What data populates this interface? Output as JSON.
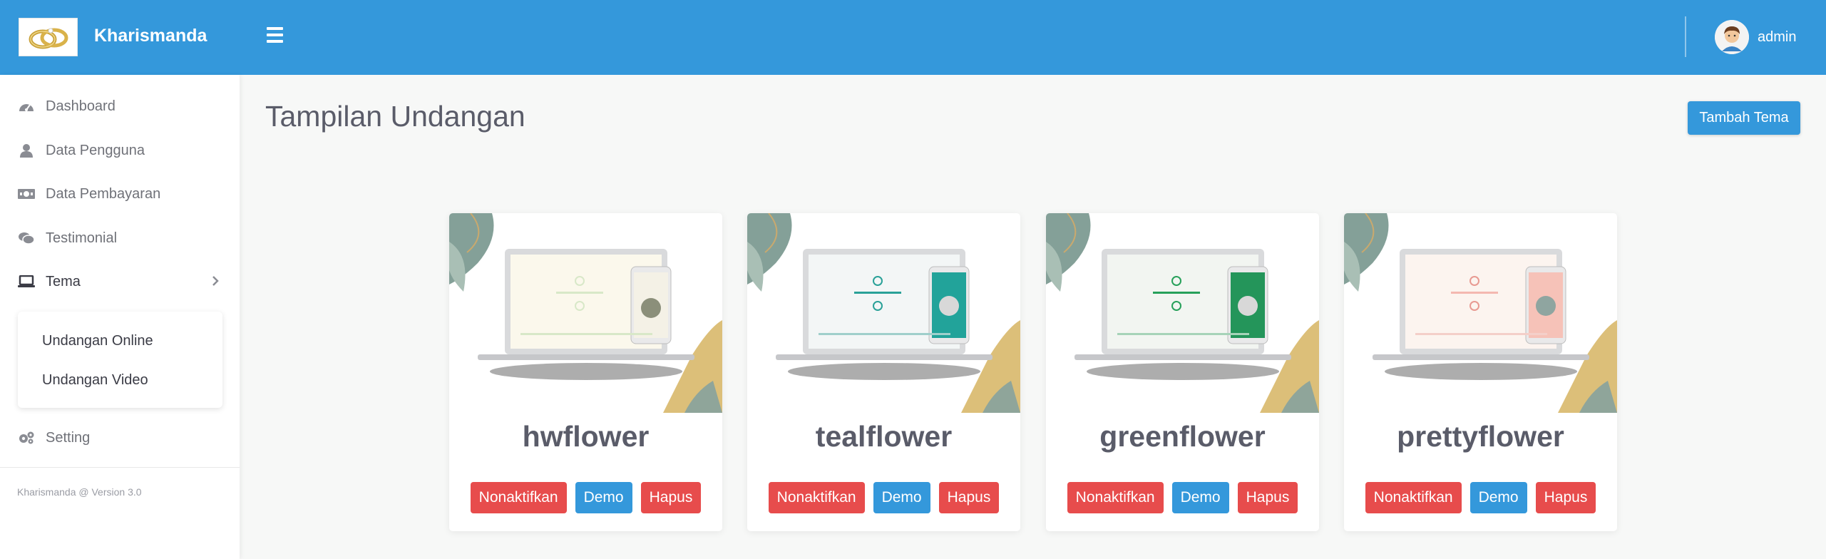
{
  "header": {
    "brand": "Kharismanda",
    "user": "admin",
    "logo_icon": "wedding-rings-icon",
    "menu_icon": "hamburger-icon"
  },
  "sidebar": {
    "items": [
      {
        "label": "Dashboard",
        "icon": "dashboard-icon"
      },
      {
        "label": "Data Pengguna",
        "icon": "user-icon"
      },
      {
        "label": "Data Pembayaran",
        "icon": "money-icon"
      },
      {
        "label": "Testimonial",
        "icon": "comments-icon"
      },
      {
        "label": "Tema",
        "icon": "laptop-icon"
      },
      {
        "label": "Setting",
        "icon": "cogs-icon"
      }
    ],
    "submenu": [
      "Undangan Online",
      "Undangan Video"
    ],
    "version": "Kharismanda @ Version 3.0"
  },
  "main": {
    "title": "Tampilan Undangan",
    "add_button": "Tambah Tema",
    "themes": [
      {
        "name": "hwflower",
        "accent": "#d8e8c8",
        "phone": "#f4f1e6"
      },
      {
        "name": "tealflower",
        "accent": "#2aa198",
        "phone": "#22a39a"
      },
      {
        "name": "greenflower",
        "accent": "#27a05a",
        "phone": "#24955a"
      },
      {
        "name": "prettyflower",
        "accent": "#f4b8b0",
        "phone": "#f6c2b8"
      }
    ],
    "actions": {
      "deactivate": "Nonaktifkan",
      "demo": "Demo",
      "delete": "Hapus"
    }
  },
  "colors": {
    "primary": "#3498db",
    "danger": "#e74c4c",
    "background": "#f7f8f7"
  }
}
